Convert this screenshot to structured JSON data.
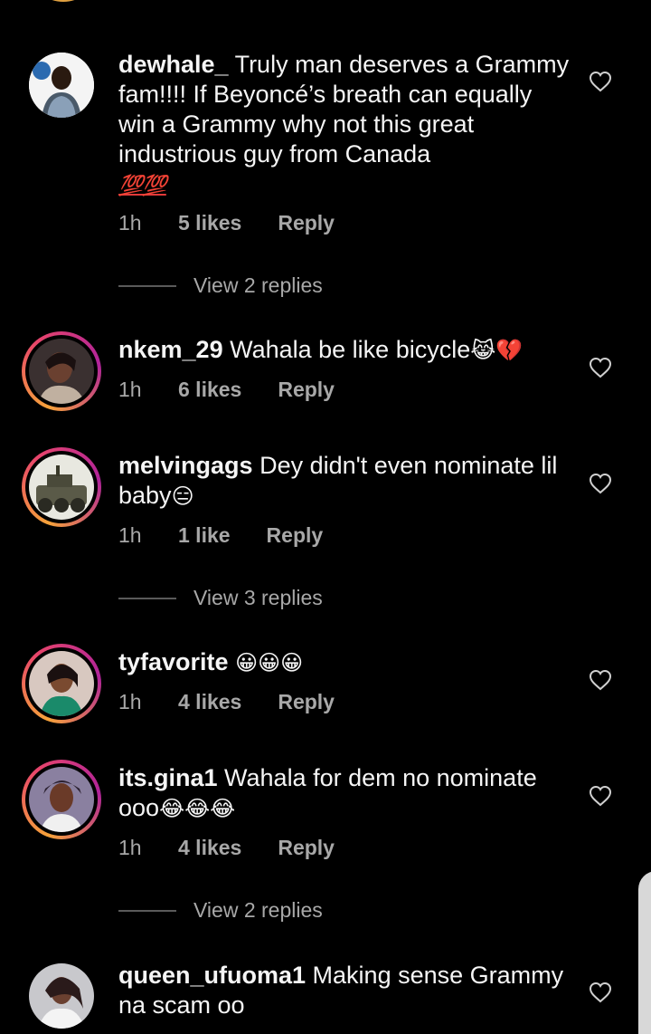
{
  "comments": [
    {
      "username": "dewhale_",
      "text": " Truly man deserves a Grammy fam!!!! If Beyoncé’s breath can equally win a Grammy why not this great industrious guy from Canada",
      "emoji": "💯💯",
      "time": "1h",
      "likes": "5 likes",
      "reply": "Reply",
      "view_replies": "View 2 replies"
    },
    {
      "username": "nkem_29",
      "text": " Wahala be like bicycle",
      "emoji": "😹💔",
      "time": "1h",
      "likes": "6 likes",
      "reply": "Reply"
    },
    {
      "username": "melvingags",
      "text": " Dey didn't even nominate lil baby",
      "emoji": "😑",
      "time": "1h",
      "likes": "1 like",
      "reply": "Reply",
      "view_replies": "View 3 replies"
    },
    {
      "username": "tyfavorite",
      "text": " ",
      "emoji": "😀😀😀",
      "time": "1h",
      "likes": "4 likes",
      "reply": "Reply"
    },
    {
      "username": "its.gina1",
      "text": " Wahala for dem no nominate ooo",
      "emoji": "😂😂😂",
      "time": "1h",
      "likes": "4 likes",
      "reply": "Reply",
      "view_replies": "View 2 replies"
    },
    {
      "username": "queen_ufuoma1",
      "text": " Making sense Grammy na scam oo",
      "emoji": ""
    }
  ],
  "icons": {
    "like": "heart-outline-icon"
  },
  "colors": {
    "background": "#000000",
    "text": "#f5f5f5",
    "muted": "#a8a8a8",
    "story_ring": [
      "#f6a23a",
      "#e8456b",
      "#b0239a"
    ]
  }
}
